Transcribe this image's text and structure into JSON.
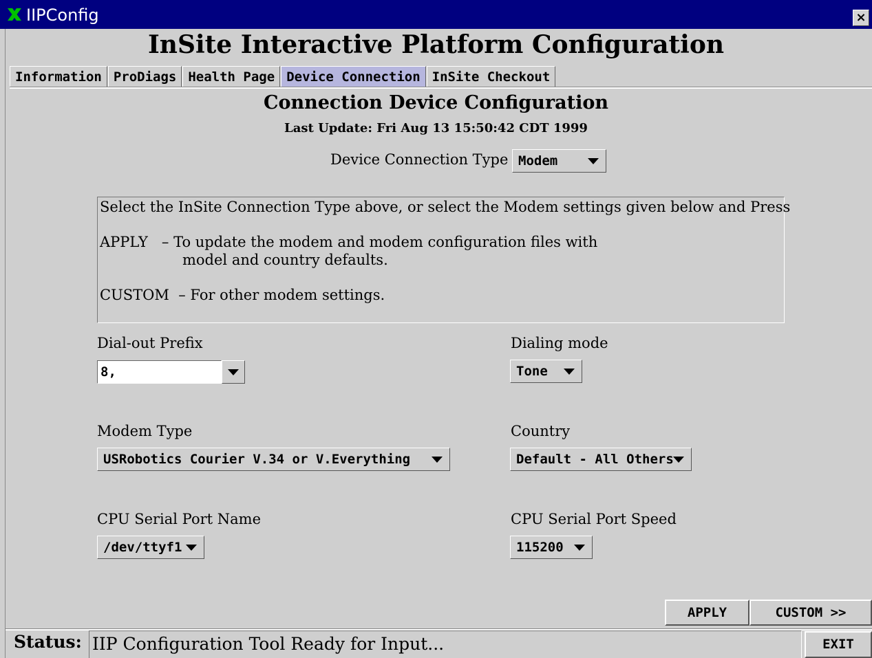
{
  "window": {
    "app_title": "IIPConfig",
    "close_label": "×"
  },
  "header": {
    "title": "InSite Interactive Platform Configuration"
  },
  "tabs": [
    {
      "label": "Information",
      "active": false
    },
    {
      "label": "ProDiags",
      "active": false
    },
    {
      "label": "Health Page",
      "active": false
    },
    {
      "label": "Device Connection",
      "active": true
    },
    {
      "label": "InSite Checkout",
      "active": false
    }
  ],
  "section": {
    "title": "Connection Device Configuration",
    "last_update": "Last Update: Fri Aug 13 15:50:42 CDT 1999"
  },
  "device_connection_type": {
    "label": "Device Connection Type",
    "value": "Modem"
  },
  "info": {
    "line1": "Select the InSite Connection Type above, or select the Modem settings given below and Press",
    "apply_line1": "APPLY   – To update the modem and modem configuration files with",
    "apply_line2": "model and country defaults.",
    "custom_line": "CUSTOM  – For other modem settings."
  },
  "fields": {
    "dialout_prefix": {
      "label": "Dial-out Prefix",
      "value": "8,"
    },
    "dialing_mode": {
      "label": "Dialing mode",
      "value": "Tone"
    },
    "modem_type": {
      "label": "Modem Type",
      "value": "USRobotics Courier V.34 or V.Everything"
    },
    "country": {
      "label": "Country",
      "value": "Default - All Others"
    },
    "serial_port_name": {
      "label": "CPU Serial Port Name",
      "value": "/dev/ttyf1"
    },
    "serial_port_speed": {
      "label": "CPU Serial Port Speed",
      "value": "115200"
    }
  },
  "buttons": {
    "apply": "APPLY",
    "custom": "CUSTOM >>",
    "exit": "EXIT"
  },
  "status": {
    "label": "Status:",
    "text": "IIP Configuration Tool Ready for Input..."
  },
  "colors": {
    "titlebar": "#000080",
    "background": "#cfcfcf",
    "active_tab": "#b6b6de"
  }
}
